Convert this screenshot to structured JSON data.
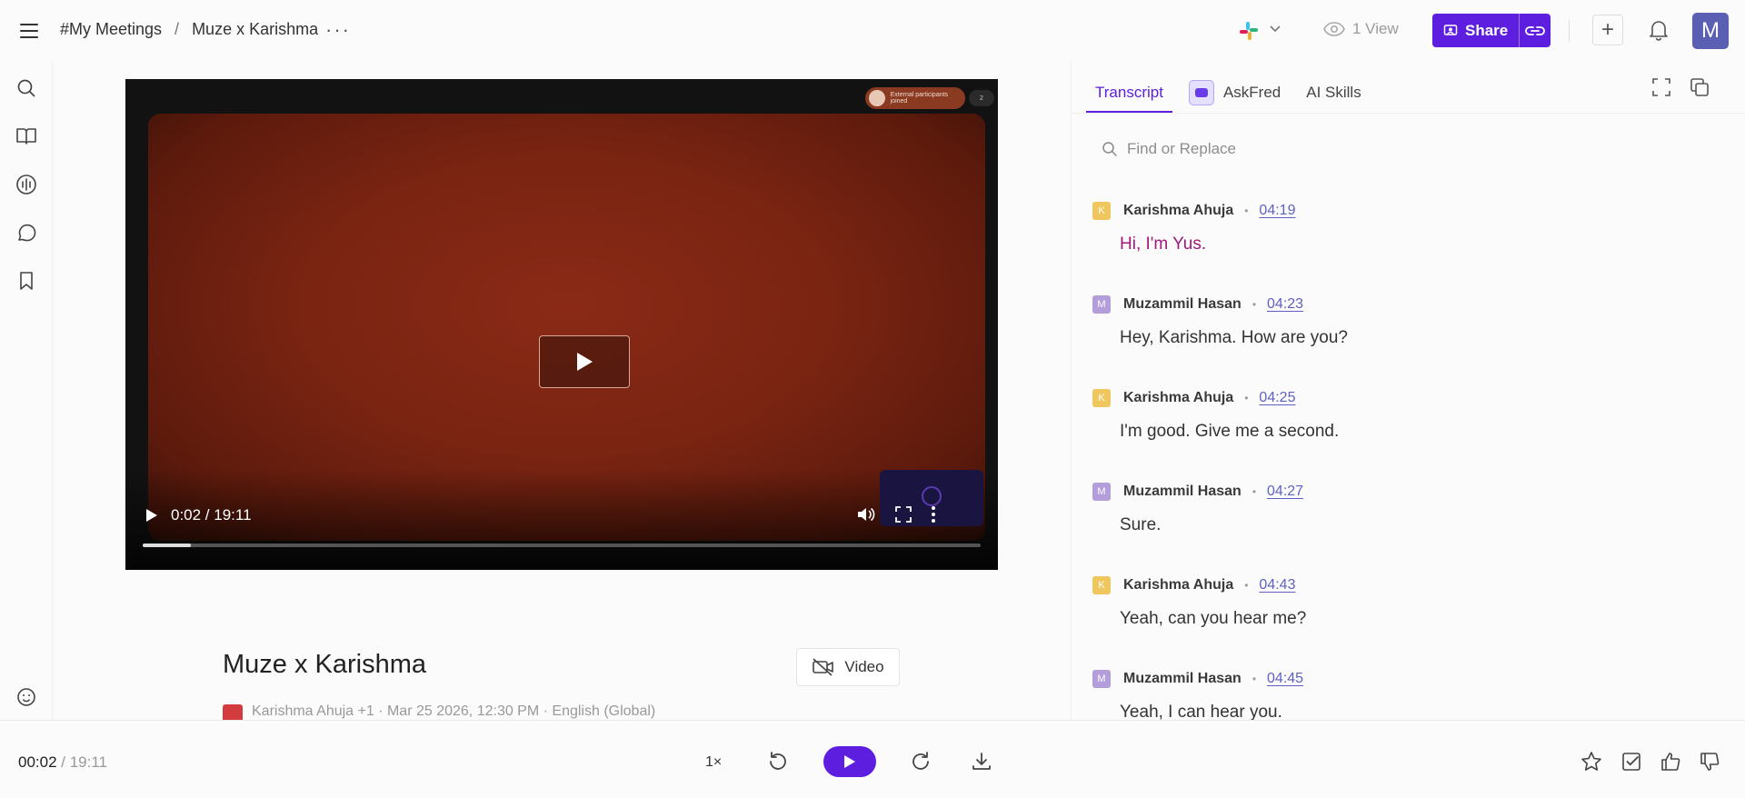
{
  "header": {
    "breadcrumb_root": "#My Meetings",
    "breadcrumb_sep": "/",
    "breadcrumb_current": "Muze x Karishma",
    "more_label": "···",
    "views_label": "1 View",
    "share_label": "Share",
    "avatar_initial": "M",
    "plus_label": "+"
  },
  "video": {
    "time_display": "0:02 / 19:11",
    "progress_fraction": 0.057,
    "badge_text": "External participants joined",
    "badge_count": "2"
  },
  "meeting": {
    "title": "Muze x Karishma",
    "video_button_label": "Video",
    "meta_text": "Karishma Ahuja  +1 · Mar 25 2026, 12:30 PM · English (Global)"
  },
  "panel": {
    "tabs": [
      {
        "label": "Transcript"
      },
      {
        "label": "AskFred"
      },
      {
        "label": "AI Skills"
      }
    ],
    "search_placeholder": "Find or Replace"
  },
  "transcript": [
    {
      "initial": "K",
      "speaker": "Karishma Ahuja",
      "time": "04:19",
      "text": "Hi, I'm Yus.",
      "color": "#f0c75e"
    },
    {
      "initial": "M",
      "speaker": "Muzammil Hasan",
      "time": "04:23",
      "text": "Hey, Karishma. How are you?",
      "color": "#b39ddb"
    },
    {
      "initial": "K",
      "speaker": "Karishma Ahuja",
      "time": "04:25",
      "text": "I'm good. Give me a second.",
      "color": "#f0c75e"
    },
    {
      "initial": "M",
      "speaker": "Muzammil Hasan",
      "time": "04:27",
      "text": "Sure.",
      "color": "#b39ddb"
    },
    {
      "initial": "K",
      "speaker": "Karishma Ahuja",
      "time": "04:43",
      "text": "Yeah, can you hear me?",
      "color": "#f0c75e"
    },
    {
      "initial": "M",
      "speaker": "Muzammil Hasan",
      "time": "04:45",
      "text": "Yeah, I can hear you.",
      "color": "#b39ddb"
    }
  ],
  "player": {
    "current": "00:02",
    "duration": " / 19:11",
    "speed": "1×"
  },
  "colors": {
    "accent": "#5d1ee0",
    "highlight_text": "#a0187a",
    "timestamp": "#5f61c2"
  }
}
